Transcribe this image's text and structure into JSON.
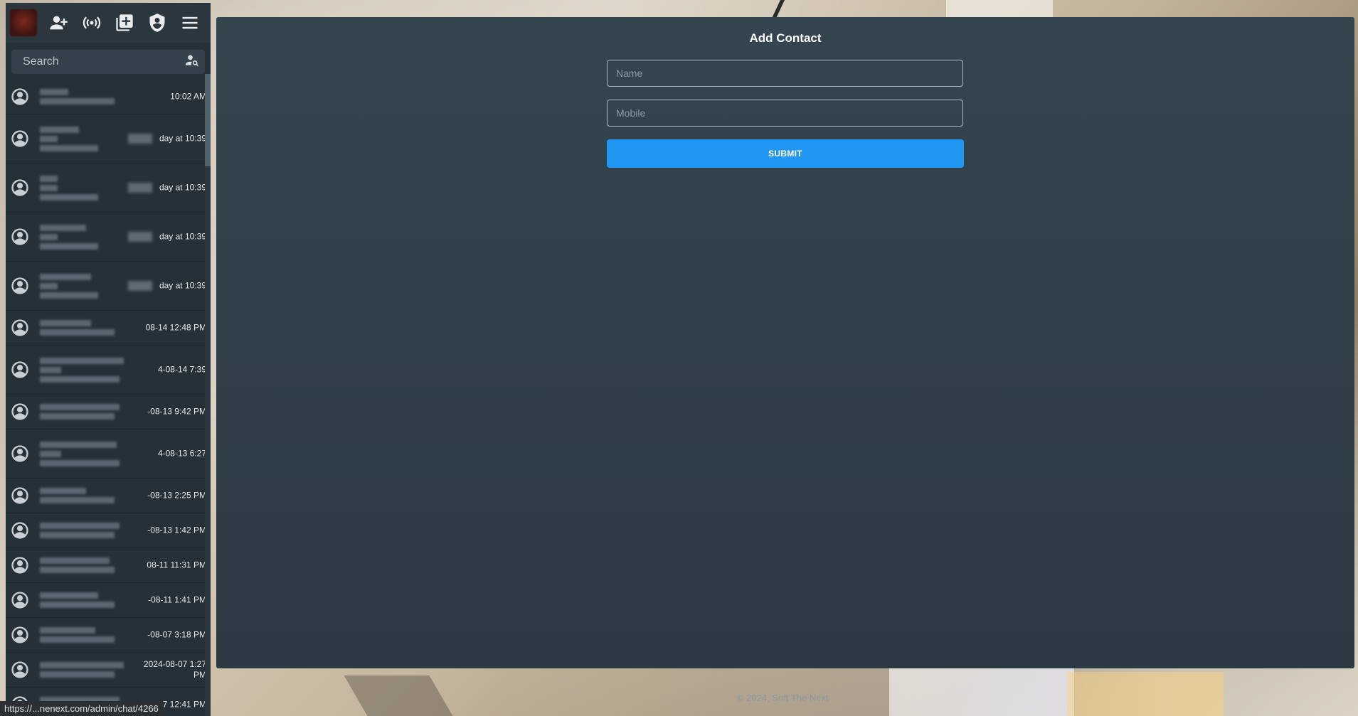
{
  "toolbar": {
    "icons": [
      "add-contact-icon",
      "broadcast-icon",
      "add-box-icon",
      "admin-shield-icon",
      "menu-icon"
    ]
  },
  "search": {
    "placeholder": "Search"
  },
  "chat_list": {
    "items": [
      {
        "time": "10:02 AM"
      },
      {
        "time": "day at 10:39"
      },
      {
        "time": "day at 10:39"
      },
      {
        "time": "day at 10:39"
      },
      {
        "time": "day at 10:39"
      },
      {
        "time": "08-14 12:48 PM"
      },
      {
        "time": "4-08-14 7:39"
      },
      {
        "time": "-08-13 9:42 PM"
      },
      {
        "time": "4-08-13 6:27"
      },
      {
        "time": "-08-13 2:25 PM"
      },
      {
        "time": "-08-13 1:42 PM"
      },
      {
        "time": "08-11 11:31 PM"
      },
      {
        "time": "-08-11 1:41 PM"
      },
      {
        "time": "-08-07 3:18 PM"
      },
      {
        "time": "2024-08-07 1:27 PM"
      },
      {
        "time": "08-07 12:41 PM"
      }
    ]
  },
  "main": {
    "title": "Add Contact",
    "name_placeholder": "Name",
    "mobile_placeholder": "Mobile",
    "submit_label": "SUBMIT"
  },
  "footer": {
    "text": "© 2024, Soft The Next"
  },
  "status_bar": {
    "url": "https://...nenext.com/admin/chat/4266"
  },
  "colors": {
    "accent": "#2196f3",
    "panel": "#2f3e47",
    "sidebar": "#253038"
  }
}
